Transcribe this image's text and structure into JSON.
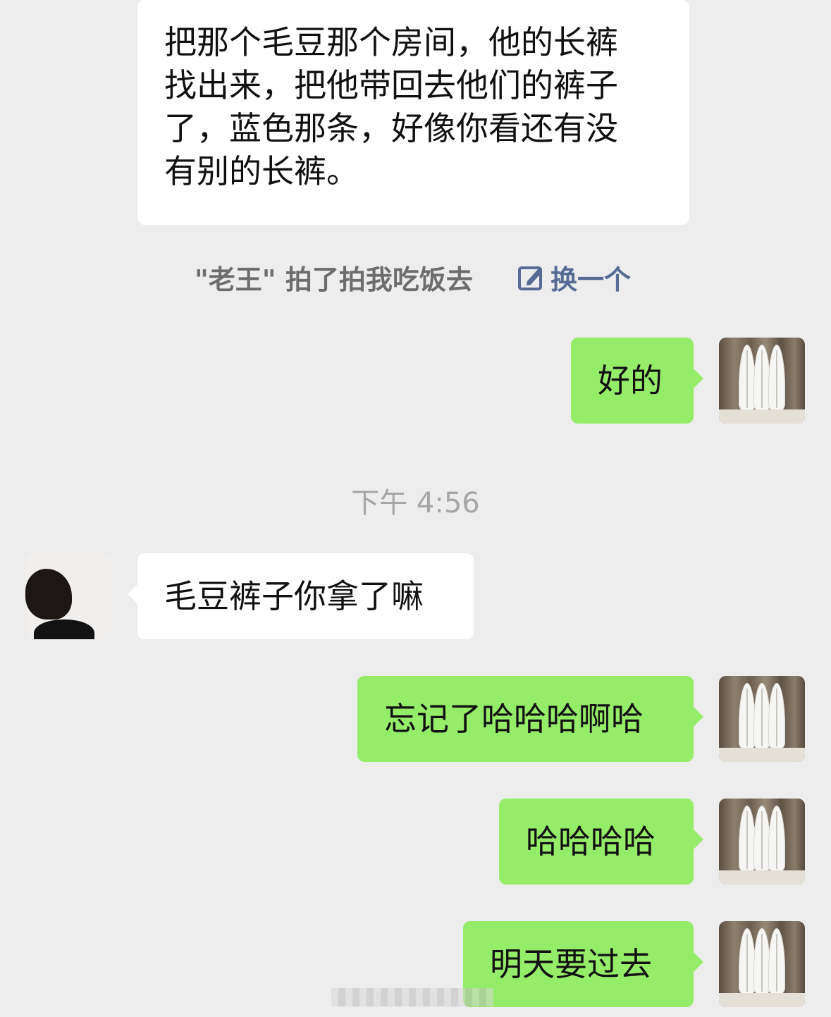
{
  "chat": {
    "messages": [
      {
        "side": "incoming",
        "lines": [
          "把那个毛豆那个房间，他的长裤",
          "找出来，把他带回去他们的裤子",
          "了，蓝色那条，好像你看还有没",
          "有别的长裤。"
        ]
      },
      {
        "side": "outgoing",
        "text": "好的"
      },
      {
        "side": "incoming",
        "text": "毛豆裤子你拿了嘛"
      },
      {
        "side": "outgoing",
        "text": "忘记了哈哈哈啊哈"
      },
      {
        "side": "outgoing",
        "text": "哈哈哈哈"
      },
      {
        "side": "outgoing",
        "text": "明天要过去"
      }
    ],
    "pat": {
      "text": "\"老王\" 拍了拍我吃饭去",
      "action_label": "换一个"
    },
    "time_separator": "下午 4:56"
  },
  "avatars": {
    "self_icon": "surfboard-avatar",
    "other_icon": "woman-silhouette-avatar"
  },
  "colors": {
    "background": "#ededed",
    "incoming_bubble": "#ffffff",
    "outgoing_bubble": "#95ec69",
    "link": "#576b95",
    "system_text": "#6d6d6d"
  }
}
